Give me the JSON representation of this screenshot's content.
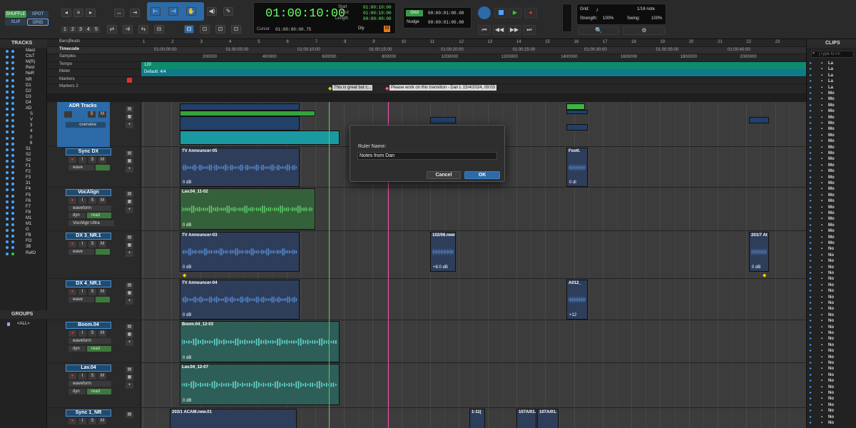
{
  "toolbar": {
    "modes": [
      "SHUFFLE",
      "SPOT",
      "SLIP",
      "GRID"
    ],
    "zoom_presets": [
      "1",
      "2",
      "3",
      "4",
      "5"
    ],
    "main_counter": "01:00:10:00",
    "start_label": "Start",
    "end_label": "End",
    "length_label": "Length",
    "start": "01:00:10:00",
    "end": "01:00:10:00",
    "length": "00:00:00:00",
    "cursor_label": "Cursor",
    "cursor_value": "01:00:00:00.75",
    "dly_label": "Dly",
    "grid_label": "Grid",
    "grid_value": "00:00:01:00.00",
    "nudge_label": "Nudge",
    "nudge_value": "00:00:01:00.00",
    "grid_panel": {
      "grid_label": "Grid:",
      "grid_value": "1/16 note",
      "strength_label": "Strength:",
      "strength_value": "100%",
      "swing_label": "Swing:",
      "swing_value": "100%"
    }
  },
  "tracks_panel": {
    "title": "TRACKS",
    "items": [
      "Mast",
      "CtsT",
      "M(R)",
      "Rest",
      "NeR",
      "NR",
      "D1",
      "D2",
      "D3",
      "D4",
      "AD",
      "S",
      "V",
      "3",
      "4",
      "0",
      "6",
      "S1",
      "S2",
      "S2",
      "F1",
      "F2",
      "F3",
      "31",
      "F4",
      "F5",
      "F6",
      "F7",
      "F8",
      "M1",
      "M1",
      "G",
      "FB",
      "FO",
      "3B",
      "RefO"
    ]
  },
  "groups_panel": {
    "title": "GROUPS",
    "items": [
      "<ALL>"
    ]
  },
  "clips_panel": {
    "title": "CLIPS",
    "search_placeholder": "(Type to Fil",
    "items": [
      "La",
      "La",
      "La",
      "La",
      "La",
      "Mo",
      "Mo",
      "Mo",
      "Mo",
      "Mo",
      "Mo",
      "Mo",
      "Mo",
      "Mo",
      "Mo",
      "Mo",
      "Mo",
      "Mo",
      "Mo",
      "Mo",
      "Mo",
      "Mo",
      "Mo",
      "Mo",
      "Mo",
      "Mo",
      "Mo",
      "Mo",
      "Mo",
      "Mo",
      "Mo",
      "No",
      "No",
      "No",
      "No",
      "No",
      "No",
      "No",
      "No",
      "No",
      "No",
      "No",
      "No",
      "No",
      "No",
      "No",
      "No",
      "No",
      "No",
      "No",
      "No",
      "No",
      "No",
      "No",
      "No",
      "No",
      "No",
      "No",
      "No",
      "No",
      "No"
    ]
  },
  "rulers": {
    "bars_label": "Bars|Beats",
    "timecode_label": "Timecode",
    "samples_label": "Samples",
    "tempo_label": "Tempo",
    "meter_label": "Meter",
    "markers_label": "Markers",
    "markers2_label": "Markers 2",
    "bars": [
      "1",
      "2",
      "3",
      "4",
      "5",
      "6",
      "7",
      "8",
      "9",
      "10",
      "11",
      "12",
      "13",
      "14",
      "15",
      "16",
      "17",
      "18",
      "19",
      "20",
      "21",
      "22",
      "23"
    ],
    "timecodes": [
      "01:00:00:00",
      "01:00:05:00",
      "01:00:10:00",
      "01:00:15:00",
      "01:00:20:00",
      "01:00:25:00",
      "01:00:30:00",
      "01:00:35:00",
      "01:00:40:00"
    ],
    "samples": [
      "200000",
      "400000",
      "600000",
      "800000",
      "1000000",
      "1200000",
      "1400000",
      "1600000",
      "1800000",
      "2000000"
    ],
    "tempo": "120",
    "meter": "Default: 4/4",
    "marker1": "This is great but c...",
    "marker2": "Please work on this transition - Dan L 15/4/2024, 09:03"
  },
  "tracks": [
    {
      "name": "ADR Tracks",
      "mode": "overview"
    },
    {
      "name": "Sync DX",
      "view": "wave",
      "clip": "TV Announcer-05",
      "gain": "0 dB",
      "clip2": "Footl.",
      "gain2": "0 dl"
    },
    {
      "name": "VocAlign",
      "view": "waveform",
      "auto": "dyn",
      "mode": "read",
      "plugin": "VocAlign Ultra",
      "clip": "Lav.04_11-02",
      "gain": "0 dB"
    },
    {
      "name": "DX 3_NR.1",
      "view": "wave",
      "clip": "TV Announcer-03",
      "gain": "0 dB",
      "clip2": "102/06.new",
      "gain2": "+8.0 dB",
      "clip3": "201/7 At",
      "gain3": "0 dB"
    },
    {
      "name": "DX 4_NR.1",
      "view": "wave",
      "clip": "TV Announcer-04",
      "gain": "0 dB",
      "clip2": "A012_",
      "gain2": "+12"
    },
    {
      "name": "Boom.04",
      "view": "waveform",
      "auto": "dyn",
      "mode": "read",
      "clip": "Boom.04_12-03",
      "gain": "0 dB"
    },
    {
      "name": "Lav.04",
      "view": "waveform",
      "auto": "dyn",
      "mode": "read",
      "clip": "Lav.04_12-07",
      "gain": "0 dB"
    },
    {
      "name": "Sync 1_NR",
      "clip": "203/1 ACAM.new.01",
      "clip2": "1-11(",
      "clip3": "107A/01.",
      "clip4": "107A/01."
    }
  ],
  "dialog": {
    "label": "Ruler Name:",
    "value": "Notes from Dan",
    "cancel": "Cancel",
    "ok": "OK"
  },
  "colors": {
    "accent": "#2c6aa8",
    "clip_blue": "#2d3d5a",
    "clip_green": "#35613a",
    "clip_teal": "#2e5e58",
    "counter": "#66ff66"
  }
}
